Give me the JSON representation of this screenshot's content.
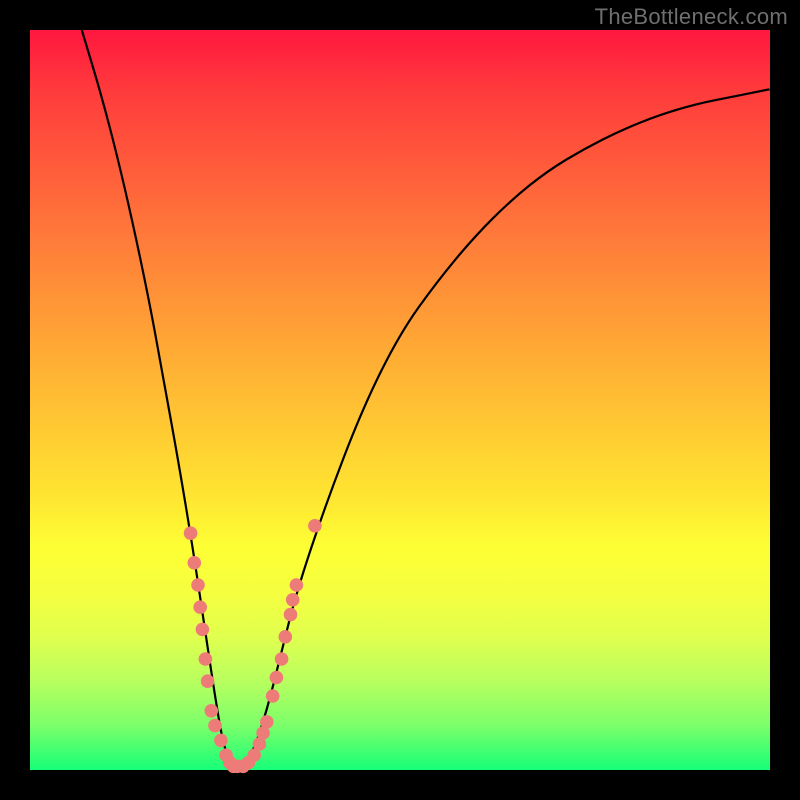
{
  "watermark": "TheBottleneck.com",
  "chart_data": {
    "type": "line",
    "title": "",
    "xlabel": "",
    "ylabel": "",
    "xlim": [
      0,
      100
    ],
    "ylim": [
      0,
      100
    ],
    "grid": false,
    "legend": null,
    "series": [
      {
        "name": "bottleneck-curve",
        "color": "#000000",
        "x": [
          7,
          10,
          13,
          16,
          18,
          20,
          22,
          23.5,
          25,
          26,
          27,
          28,
          30,
          32,
          34,
          36,
          40,
          45,
          50,
          55,
          60,
          65,
          70,
          75,
          80,
          85,
          90,
          95,
          100
        ],
        "y": [
          100,
          90,
          78,
          64,
          53,
          42,
          30,
          20,
          10,
          4,
          1,
          0,
          2,
          8,
          16,
          24,
          36,
          49,
          59,
          66,
          72,
          77,
          81,
          84,
          86.5,
          88.5,
          90,
          91,
          92
        ]
      }
    ],
    "scatter_points": {
      "name": "sample-points",
      "color": "#ed7c78",
      "points": [
        {
          "x": 21.7,
          "y": 32
        },
        {
          "x": 22.2,
          "y": 28
        },
        {
          "x": 22.7,
          "y": 25
        },
        {
          "x": 23.0,
          "y": 22
        },
        {
          "x": 23.3,
          "y": 19
        },
        {
          "x": 23.7,
          "y": 15
        },
        {
          "x": 24.0,
          "y": 12
        },
        {
          "x": 24.5,
          "y": 8
        },
        {
          "x": 25.0,
          "y": 6
        },
        {
          "x": 25.8,
          "y": 4
        },
        {
          "x": 26.5,
          "y": 2
        },
        {
          "x": 27.0,
          "y": 1
        },
        {
          "x": 27.5,
          "y": 0.5
        },
        {
          "x": 28.0,
          "y": 0.5
        },
        {
          "x": 28.8,
          "y": 0.5
        },
        {
          "x": 29.5,
          "y": 1
        },
        {
          "x": 30.3,
          "y": 2
        },
        {
          "x": 31.0,
          "y": 3.5
        },
        {
          "x": 31.5,
          "y": 5
        },
        {
          "x": 32.0,
          "y": 6.5
        },
        {
          "x": 32.8,
          "y": 10
        },
        {
          "x": 33.3,
          "y": 12.5
        },
        {
          "x": 34.0,
          "y": 15
        },
        {
          "x": 34.5,
          "y": 18
        },
        {
          "x": 35.2,
          "y": 21
        },
        {
          "x": 35.5,
          "y": 23
        },
        {
          "x": 36.0,
          "y": 25
        },
        {
          "x": 38.5,
          "y": 33
        }
      ]
    }
  }
}
